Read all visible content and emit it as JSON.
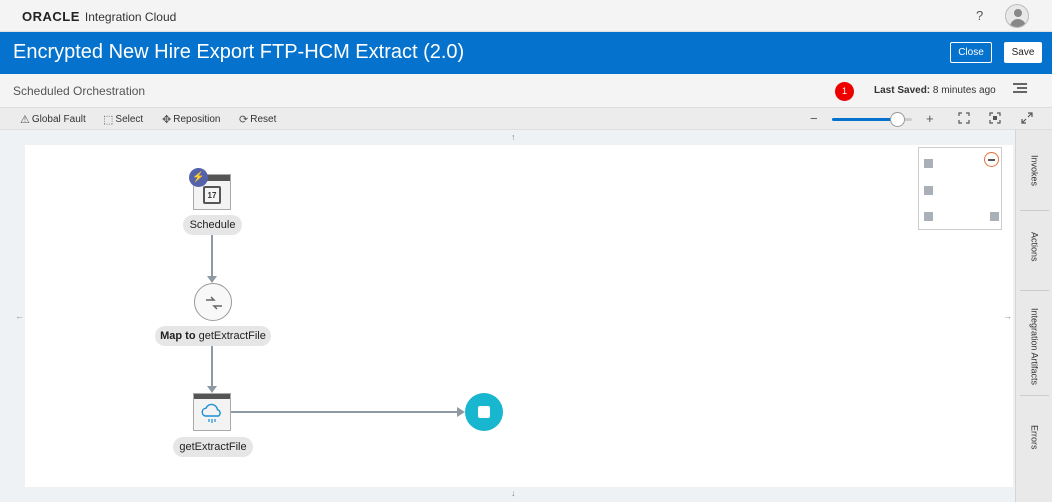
{
  "header": {
    "brand": "ORACLE",
    "product": "Integration Cloud",
    "help": "?"
  },
  "titlebar": {
    "title": "Encrypted New Hire Export FTP-HCM Extract (2.0)",
    "close_label": "Close",
    "save_label": "Save",
    "color": "#0572ce"
  },
  "subheader": {
    "title": "Scheduled Orchestration",
    "error_count": "1",
    "last_saved_label": "Last Saved:",
    "last_saved_value": "8 minutes ago"
  },
  "toolbar": {
    "global_fault": "Global Fault",
    "select": "Select",
    "reposition": "Reposition",
    "reset": "Reset",
    "zoom_minus": "−",
    "zoom_plus": "+",
    "zoom_level": 0.82
  },
  "flow": {
    "schedule_label": "Schedule",
    "calendar_day": "17",
    "map_bold": "Map to",
    "map_rest": " getExtractFile",
    "invoke_label": "getExtractFile",
    "stop_color": "#18b6cf"
  },
  "sidepanel": {
    "invokes": "Invokes",
    "actions": "Actions",
    "artifacts": "Integration Artifacts",
    "errors": "Errors"
  },
  "icons": {
    "help": "question-icon",
    "avatar": "user-avatar-icon",
    "menu": "hamburger-menu-icon",
    "warning": "warning-icon",
    "select": "select-icon",
    "reposition": "move-icon",
    "reset": "reset-icon",
    "fit": "fit-screen-icon",
    "focus": "focus-icon",
    "expand": "expand-icon"
  }
}
